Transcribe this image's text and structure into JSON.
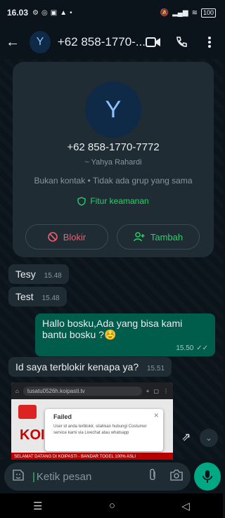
{
  "status_bar": {
    "time": "16.03",
    "battery": "100"
  },
  "header": {
    "avatar_letter": "Y",
    "title": "+62 858-1770-..."
  },
  "contact_card": {
    "avatar_letter": "Y",
    "phone": "+62 858-1770-7772",
    "push_name": "~ Yahya Rahardi",
    "info": "Bukan kontak • Tidak ada grup yang sama",
    "security_label": "Fitur keamanan",
    "block_label": "Blokir",
    "add_label": "Tambah"
  },
  "messages": [
    {
      "dir": "in",
      "text": "Tesy",
      "time": "15.48"
    },
    {
      "dir": "in",
      "text": "Test",
      "time": "15.48"
    },
    {
      "dir": "out",
      "text": "Hallo bosku,Ada yang bisa kami bantu bosku ?☺️",
      "time": "15.50",
      "ticks": "✓✓"
    },
    {
      "dir": "in",
      "text": "Id saya terblokir kenapa ya?",
      "time": "15.51"
    }
  ],
  "screenshot": {
    "url": "tusatu0526h.koipasti.tv",
    "brand": "KOI",
    "banner": "SELAMAT DATANG DI KOIPASTI - BANDAR TOGEL 100% ASLI",
    "dialog_title": "Failed",
    "dialog_text": "User id anda terblokir, silahkan hubungi Costumer service kami via Livechat atau whatsapp"
  },
  "composer": {
    "placeholder": "Ketik pesan"
  },
  "colors": {
    "accent": "#25d366",
    "danger": "#f15c6d",
    "outgoing": "#005c4b",
    "incoming": "#1f2c33"
  }
}
